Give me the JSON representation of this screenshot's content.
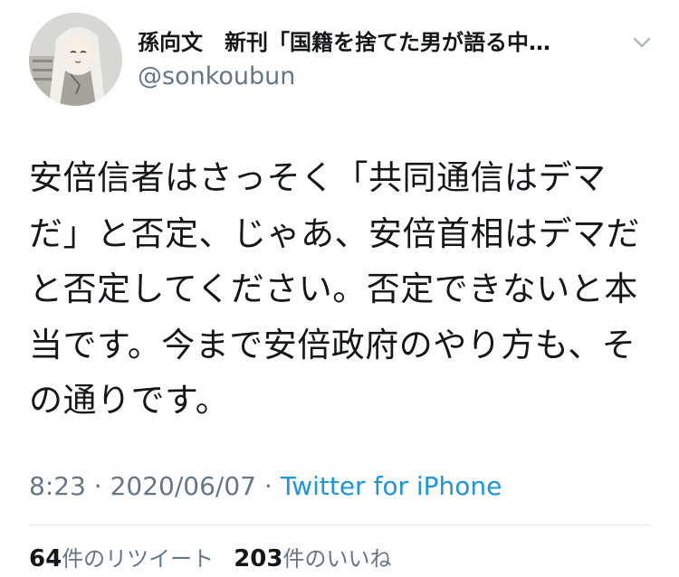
{
  "tweet": {
    "author": {
      "display_name": "孫向文　新刊「国籍を捨てた男が語る中…",
      "handle": "@sonkoubun",
      "avatar_icon": "avatar-illustration"
    },
    "menu_icon": "chevron-down-icon",
    "text": "安倍信者はさっそく「共同通信はデマだ」と否定、じゃあ、安倍首相はデマだと否定してください。否定できないと本当です。今まで安倍政府のやり方も、その通りです。",
    "time": "8:23",
    "separator": "·",
    "date": "2020/06/07",
    "source": "Twitter for iPhone",
    "retweets": {
      "count": "64",
      "label": "件のリツイート"
    },
    "likes": {
      "count": "203",
      "label": "件のいいね"
    }
  },
  "colors": {
    "text": "#14171a",
    "secondary": "#657786",
    "link": "#1b95e0",
    "divider": "#e1e8ed"
  }
}
